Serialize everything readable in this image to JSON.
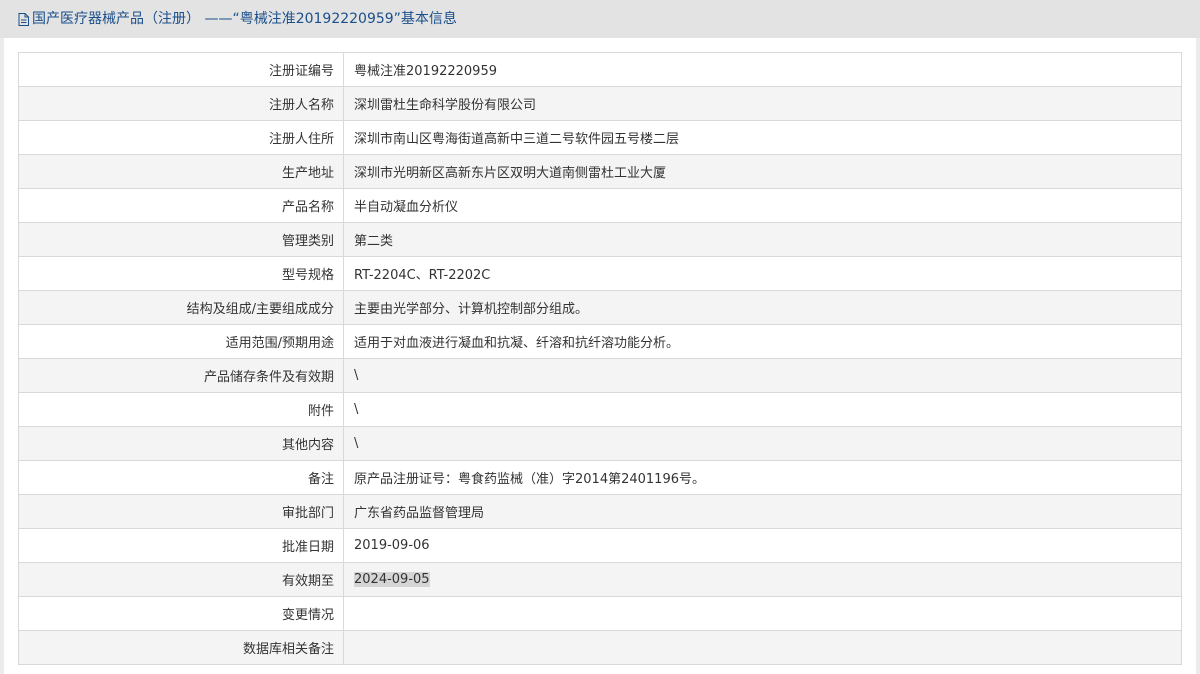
{
  "header": {
    "title": "国产医疗器械产品（注册） ——“粤械注准20192220959”基本信息"
  },
  "rows": [
    {
      "label": "注册证编号",
      "value": "粤械注准20192220959"
    },
    {
      "label": "注册人名称",
      "value": "深圳雷杜生命科学股份有限公司"
    },
    {
      "label": "注册人住所",
      "value": "深圳市南山区粤海街道高新中三道二号软件园五号楼二层"
    },
    {
      "label": "生产地址",
      "value": "深圳市光明新区高新东片区双明大道南侧雷杜工业大厦"
    },
    {
      "label": "产品名称",
      "value": "半自动凝血分析仪"
    },
    {
      "label": "管理类别",
      "value": "第二类"
    },
    {
      "label": "型号规格",
      "value": "RT-2204C、RT-2202C"
    },
    {
      "label": "结构及组成/主要组成成分",
      "value": "主要由光学部分、计算机控制部分组成。"
    },
    {
      "label": "适用范围/预期用途",
      "value": "适用于对血液进行凝血和抗凝、纤溶和抗纤溶功能分析。"
    },
    {
      "label": "产品储存条件及有效期",
      "value": "\\"
    },
    {
      "label": "附件",
      "value": "\\"
    },
    {
      "label": "其他内容",
      "value": "\\"
    },
    {
      "label": "备注",
      "value": "原产品注册证号：粤食药监械（准）字2014第2401196号。"
    },
    {
      "label": "审批部门",
      "value": "广东省药品监督管理局"
    },
    {
      "label": "批准日期",
      "value": "2019-09-06"
    },
    {
      "label": "有效期至",
      "value": "2024-09-05"
    },
    {
      "label": "变更情况",
      "value": ""
    },
    {
      "label": "数据库相关备注",
      "value": ""
    }
  ]
}
